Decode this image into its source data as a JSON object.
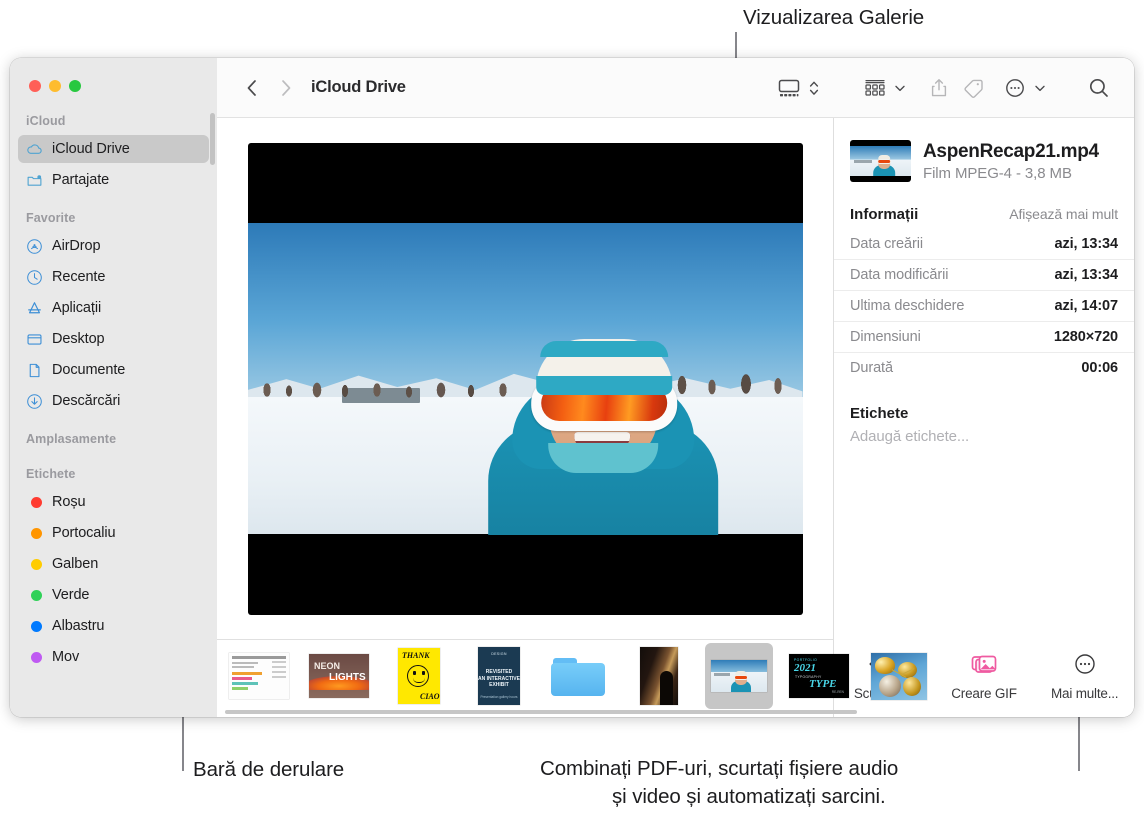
{
  "annotations": [
    {
      "id": "gallery_view",
      "text": "Vizualizarea Galerie"
    },
    {
      "id": "scrollbar",
      "text": "Bară de derulare"
    },
    {
      "id": "quick_actions_l1",
      "text": "Combinați PDF-uri, scurtați fișiere audio"
    },
    {
      "id": "quick_actions_l2",
      "text": "și video și automatizați sarcini."
    }
  ],
  "window": {
    "traffic_lights": [
      {
        "name": "close",
        "color": "#ff5f57"
      },
      {
        "name": "minimize",
        "color": "#febc2e"
      },
      {
        "name": "zoom",
        "color": "#28c840"
      }
    ]
  },
  "sidebar": {
    "sections": [
      {
        "header": "iCloud",
        "items": [
          {
            "label": "iCloud Drive",
            "icon": "cloud-icon",
            "selected": true
          },
          {
            "label": "Partajate",
            "icon": "shared-folder-icon",
            "selected": false
          }
        ]
      },
      {
        "header": "Favorite",
        "items": [
          {
            "label": "AirDrop",
            "icon": "airdrop-icon",
            "selected": false
          },
          {
            "label": "Recente",
            "icon": "clock-icon",
            "selected": false
          },
          {
            "label": "Aplicații",
            "icon": "applications-icon",
            "selected": false
          },
          {
            "label": "Desktop",
            "icon": "desktop-icon",
            "selected": false
          },
          {
            "label": "Documente",
            "icon": "document-icon",
            "selected": false
          },
          {
            "label": "Descărcări",
            "icon": "downloads-icon",
            "selected": false
          }
        ]
      },
      {
        "header": "Amplasamente",
        "items": []
      },
      {
        "header": "Etichete",
        "items": [
          {
            "label": "Roșu",
            "icon": "tag-dot-icon",
            "color": "#ff3b30"
          },
          {
            "label": "Portocaliu",
            "icon": "tag-dot-icon",
            "color": "#ff9500"
          },
          {
            "label": "Galben",
            "icon": "tag-dot-icon",
            "color": "#ffcc00"
          },
          {
            "label": "Verde",
            "icon": "tag-dot-icon",
            "color": "#30d158"
          },
          {
            "label": "Albastru",
            "icon": "tag-dot-icon",
            "color": "#007aff"
          },
          {
            "label": "Mov",
            "icon": "tag-dot-icon",
            "color": "#bf5af2"
          }
        ]
      }
    ]
  },
  "toolbar": {
    "back_icon": "chevron-left-icon",
    "forward_icon": "chevron-right-icon",
    "title": "iCloud Drive",
    "view_gallery_icon": "gallery-view-icon",
    "view_stepper_icon": "chevron-up-down-icon",
    "group_icon": "group-items-icon",
    "group_chevron_icon": "chevron-down-icon",
    "share_icon": "share-icon",
    "tag_icon": "tag-icon",
    "more_icon": "more-circle-icon",
    "more_chevron_icon": "chevron-down-icon",
    "search_icon": "search-icon"
  },
  "filmstrip": {
    "items": [
      {
        "name": "chart-document-thumbnail",
        "selected": false
      },
      {
        "name": "neon-lights-poster-thumbnail",
        "selected": false
      },
      {
        "name": "thank-you-poster-thumbnail",
        "selected": false
      },
      {
        "name": "exhibit-poster-thumbnail",
        "selected": false
      },
      {
        "name": "folder-thumbnail",
        "selected": false
      },
      {
        "name": "silhouette-photo-thumbnail",
        "selected": false
      },
      {
        "name": "aspen-video-thumbnail",
        "selected": true
      },
      {
        "name": "portfolio-2021-thumbnail",
        "selected": false
      },
      {
        "name": "balloons-photo-thumbnail",
        "selected": false
      }
    ]
  },
  "info_panel": {
    "file_name": "AspenRecap21.mp4",
    "file_kind": "Film MPEG-4 - 3,8 MB",
    "section_title": "Informații",
    "section_action": "Afișează mai mult",
    "metadata": [
      {
        "key": "Data creării",
        "value": "azi, 13:34"
      },
      {
        "key": "Data modificării",
        "value": "azi, 13:34"
      },
      {
        "key": "Ultima deschidere",
        "value": "azi, 14:07"
      },
      {
        "key": "Dimensiuni",
        "value": "1280×720"
      },
      {
        "key": "Durată",
        "value": "00:06"
      }
    ],
    "tags_title": "Etichete",
    "tags_placeholder": "Adaugă etichete...",
    "quick_actions": [
      {
        "label": "Scurtează",
        "icon": "trim-video-icon"
      },
      {
        "label": "Creare GIF",
        "icon": "create-gif-icon",
        "color": "#ef5ba1"
      },
      {
        "label": "Mai multe...",
        "icon": "more-circle-icon"
      }
    ]
  }
}
